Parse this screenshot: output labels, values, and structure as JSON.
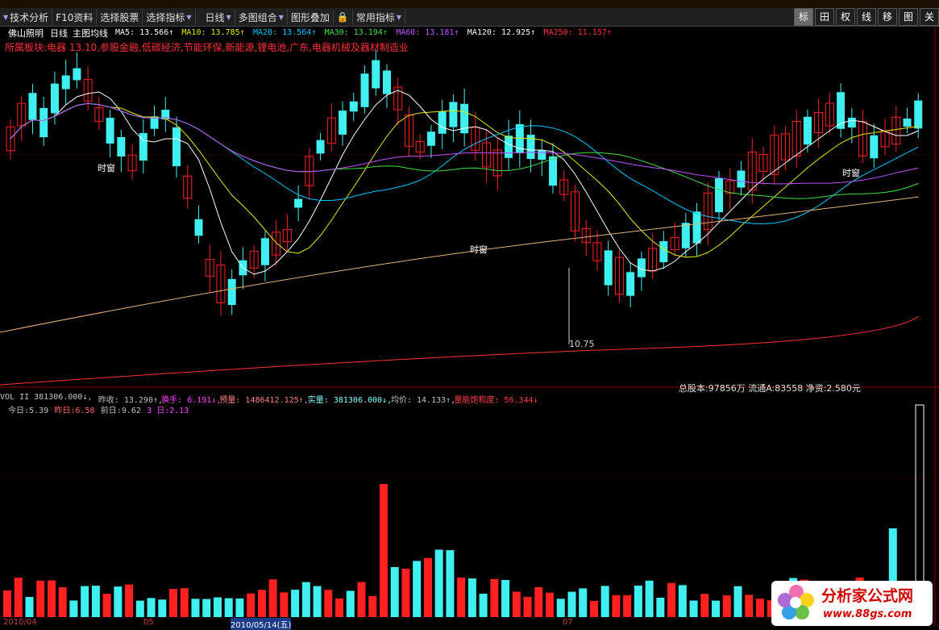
{
  "toolbar": {
    "items": [
      "技术分析",
      "F10资料",
      "选择股票",
      "选择指标",
      "日线",
      "多图组合",
      "图形叠加",
      "常用指标"
    ],
    "right_buttons": [
      "标",
      "田",
      "权",
      "线",
      "移",
      "图",
      "关"
    ]
  },
  "stock": {
    "name": "佛山照明",
    "period": "日线",
    "main_indicator": "主图均线",
    "sector_text": "所属板块:电器 13.10,参股金融,低碳经济,节能环保,新能源,锂电池,广东,电器机械及器材制造业"
  },
  "ma_legend": [
    {
      "label": "MA5: 13.566↑",
      "color": "#ffffff"
    },
    {
      "label": "MA10: 13.785↑",
      "color": "#e8e800"
    },
    {
      "label": "MA20: 13.564↑",
      "color": "#00c8ff"
    },
    {
      "label": "MA30: 13.194↑",
      "color": "#40e040"
    },
    {
      "label": "MA60: 13.181↑",
      "color": "#c050ff"
    },
    {
      "label": "MA120: 12.925↑",
      "color": "#ffffff"
    },
    {
      "label": "MA250: 11.157↑",
      "color": "#ff3030"
    }
  ],
  "annotations": {
    "low_price": "10.75",
    "timing_label": "时窗",
    "capital_info": "总股本:97856万 流通A:83558 净资:2.580元"
  },
  "volume": {
    "legend": [
      {
        "label": "VOL II 381306.000↓,",
        "color": "#c0c0c0"
      },
      {
        "label": "昨收: 13.290↑,",
        "color": "#c0c0c0"
      },
      {
        "label": "换手: 6.191↓,",
        "color": "#ff40ff"
      },
      {
        "label": "预量: 1486412.125↑,",
        "color": "#ff8080"
      },
      {
        "label": "实量: 381306.000↓,",
        "color": "#80ffff"
      },
      {
        "label": "均价: 14.133↑,",
        "color": "#c0c0c0"
      },
      {
        "label": "量能饱和度: 56.344↓",
        "color": "#ff4040"
      }
    ],
    "turnover": [
      {
        "label": "今日:5.39",
        "color": "#c0c0c0"
      },
      {
        "label": "昨日:6.58",
        "color": "#ff6060"
      },
      {
        "label": "前日:9.62",
        "color": "#c0c0c0"
      },
      {
        "label": "3 日:2.13",
        "color": "#ff40ff"
      }
    ]
  },
  "date_axis": {
    "labels": [
      "2010/04",
      "05",
      "2010/05/14(五)",
      "07"
    ]
  },
  "watermark": {
    "title": "分析家公式网",
    "url": "www.88gs.com"
  },
  "colors": {
    "up": "#ff2020",
    "down": "#40f0f0",
    "background": "#000000"
  }
}
